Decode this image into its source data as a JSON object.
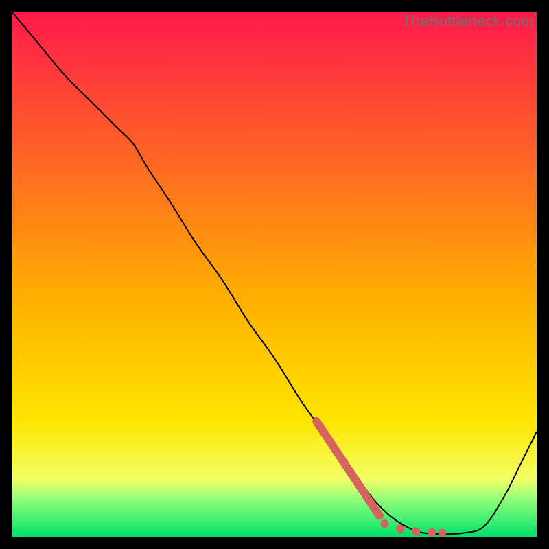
{
  "watermark": "TheBottleneck.com",
  "colors": {
    "gradient_top": "#ff1a4b",
    "gradient_yellow": "#ffe500",
    "gradient_green_light": "#8eff7a",
    "gradient_green": "#00e06a",
    "curve": "#000000",
    "dots": "#d7635f",
    "frame": "#000000"
  },
  "chart_data": {
    "type": "line",
    "title": "",
    "xlabel": "",
    "ylabel": "",
    "xlim": [
      0,
      100
    ],
    "ylim": [
      0,
      100
    ],
    "grid": false,
    "legend": false,
    "series": [
      {
        "name": "bottleneck-curve",
        "x": [
          0,
          5,
          10,
          15,
          20,
          23,
          26,
          30,
          35,
          40,
          45,
          50,
          55,
          60,
          63,
          66,
          69,
          72,
          75,
          78,
          82,
          86,
          90,
          94,
          97,
          100
        ],
        "y": [
          100,
          94,
          88,
          83,
          78,
          75,
          70,
          64,
          56,
          49,
          41,
          34,
          26,
          19,
          15,
          11,
          7,
          4,
          2,
          0.8,
          0.5,
          0.7,
          2,
          8,
          14,
          20
        ]
      }
    ],
    "markers": [
      {
        "name": "highlight-segment",
        "kind": "thick-line",
        "x": [
          58,
          70
        ],
        "y": [
          22,
          4
        ]
      },
      {
        "name": "highlight-dots",
        "kind": "dots",
        "points": [
          {
            "x": 71,
            "y": 2.5
          },
          {
            "x": 74,
            "y": 1.5
          },
          {
            "x": 77,
            "y": 1.0
          },
          {
            "x": 80,
            "y": 0.8
          },
          {
            "x": 82,
            "y": 0.7
          }
        ]
      }
    ]
  }
}
